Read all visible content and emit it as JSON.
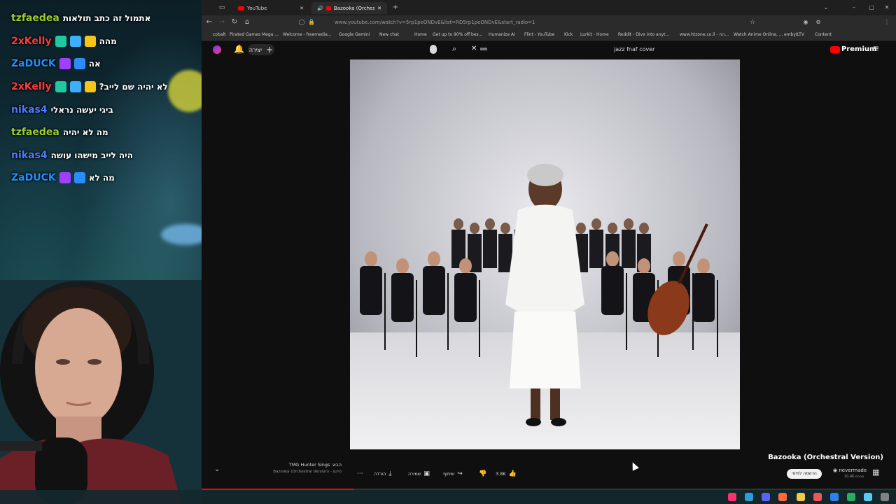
{
  "chat": [
    {
      "user": "tzfaedea",
      "color": "#9acd32",
      "text": "אתמול זה כתב תולאות",
      "badges": []
    },
    {
      "user": "2xKelly",
      "color": "#ff3b3b",
      "text": "מהה",
      "badges": [
        "#1ec8a0",
        "#3ab0ff",
        "#f5c518"
      ]
    },
    {
      "user": "ZaDUCK",
      "color": "#1e90ff",
      "text": "אה",
      "badges": [
        "#a040ff",
        "#2a8cff"
      ]
    },
    {
      "user": "2xKelly",
      "color": "#ff3b3b",
      "text": "לא יהיה שם לייב?",
      "badges": [
        "#1ec8a0",
        "#3ab0ff",
        "#f5c518"
      ]
    },
    {
      "user": "nikas4",
      "color": "#4a7bff",
      "text": "ביגי יעשה נראלי",
      "badges": []
    },
    {
      "user": "tzfaedea",
      "color": "#9acd32",
      "text": "מה לא יהיה",
      "badges": []
    },
    {
      "user": "nikas4",
      "color": "#4a7bff",
      "text": "היה לייב מישהו עושה",
      "badges": []
    },
    {
      "user": "ZaDUCK",
      "color": "#1e90ff",
      "text": "מה לא",
      "badges": [
        "#a040ff",
        "#2a8cff"
      ]
    }
  ],
  "tabs": [
    {
      "label": "YouTube"
    },
    {
      "label": "Bazooka (Orchestral Version)"
    }
  ],
  "url": "www.youtube.com/watch?v=5rp1peONDvE&list=RD5rp1peONDvE&start_radio=1",
  "bookmarks": [
    "cobalt",
    "Pirated Games Mega ...",
    "Welcome - freemedia...",
    "Google Gemini",
    "New chat",
    "Home",
    "Get up to 90% off bes...",
    "Humanize AI",
    "Flint - YouTube",
    "Kick",
    "Lurkit - Home",
    "Reddit - Dive into anyt...",
    "www.htzone.co.il - הח...",
    "Watch Anime Online, ...",
    "embyILTV",
    "Content"
  ],
  "yt": {
    "create_label": "יצירה",
    "search_query": "jazz fnaf cover",
    "premium_label": "Premium"
  },
  "video": {
    "title": "Bazooka (Orchestral Version)",
    "channel": "nevermade",
    "subscribers": "10.4K מנויים",
    "subscribe_label": "הרשמה למינוי",
    "likes": "3.8K",
    "share_label": "שיתוף",
    "save_label": "שמירה",
    "download_label": "הורדה",
    "more_label": "···"
  },
  "next": {
    "label": "TMG Hunter Sings :הבא",
    "sub": "Bazooka (Orchestral Version) - מיקס"
  }
}
